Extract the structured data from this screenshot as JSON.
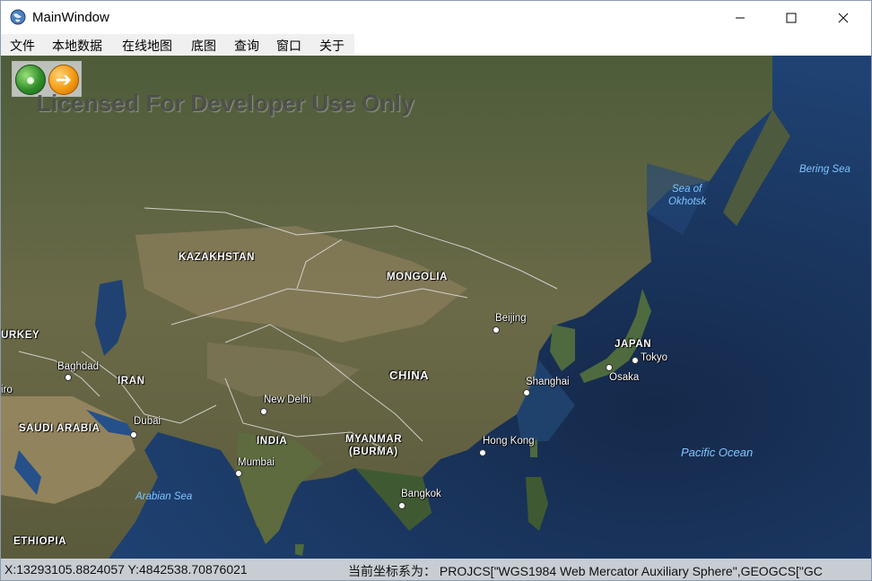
{
  "window": {
    "title": "MainWindow"
  },
  "menu": {
    "items": [
      "文件",
      "本地数据",
      "在线地图",
      "底图",
      "查询",
      "窗口",
      "关于"
    ]
  },
  "map": {
    "watermark": "Licensed For Developer Use Only",
    "toolbar": {
      "globe_icon": "globe-icon",
      "next_icon": "arrow-right-icon"
    },
    "countries": {
      "kazakhstan": "KAZAKHSTAN",
      "mongolia": "MONGOLIA",
      "turkey": "URKEY",
      "iran": "IRAN",
      "china": "CHINA",
      "japan": "JAPAN",
      "saudi": "SAUDI ARABIA",
      "india": "INDIA",
      "myanmar_1": "MYANMAR",
      "myanmar_2": "(BURMA)",
      "ethiopia": "ETHIOPIA"
    },
    "cities": {
      "beijing": "Beijing",
      "baghdad": "Baghdad",
      "cairo": "iro",
      "tokyo": "Tokyo",
      "osaka": "Osaka",
      "shanghai": "Shanghai",
      "new_delhi": "New Delhi",
      "dubai": "Dubai",
      "hong_kong": "Hong Kong",
      "mumbai": "Mumbai",
      "bangkok": "Bangkok"
    },
    "oceans": {
      "bering": "Bering Sea",
      "okhotsk_1": "Sea of",
      "okhotsk_2": "Okhotsk",
      "pacific": "Pacific Ocean",
      "arabian": "Arabian Sea"
    },
    "colors": {
      "ocean_deep": "#14294a",
      "ocean_shallow": "#2a5a8e",
      "land_dark": "#4a5a38",
      "land_arid": "#8a8060",
      "border": "#e8e8e8"
    }
  },
  "status": {
    "coords": "X:13293105.8824057  Y:4842538.70876021",
    "projection": "当前坐标系为：  PROJCS[\"WGS1984  Web  Mercator  Auxiliary  Sphere\",GEOGCS[\"GC"
  }
}
